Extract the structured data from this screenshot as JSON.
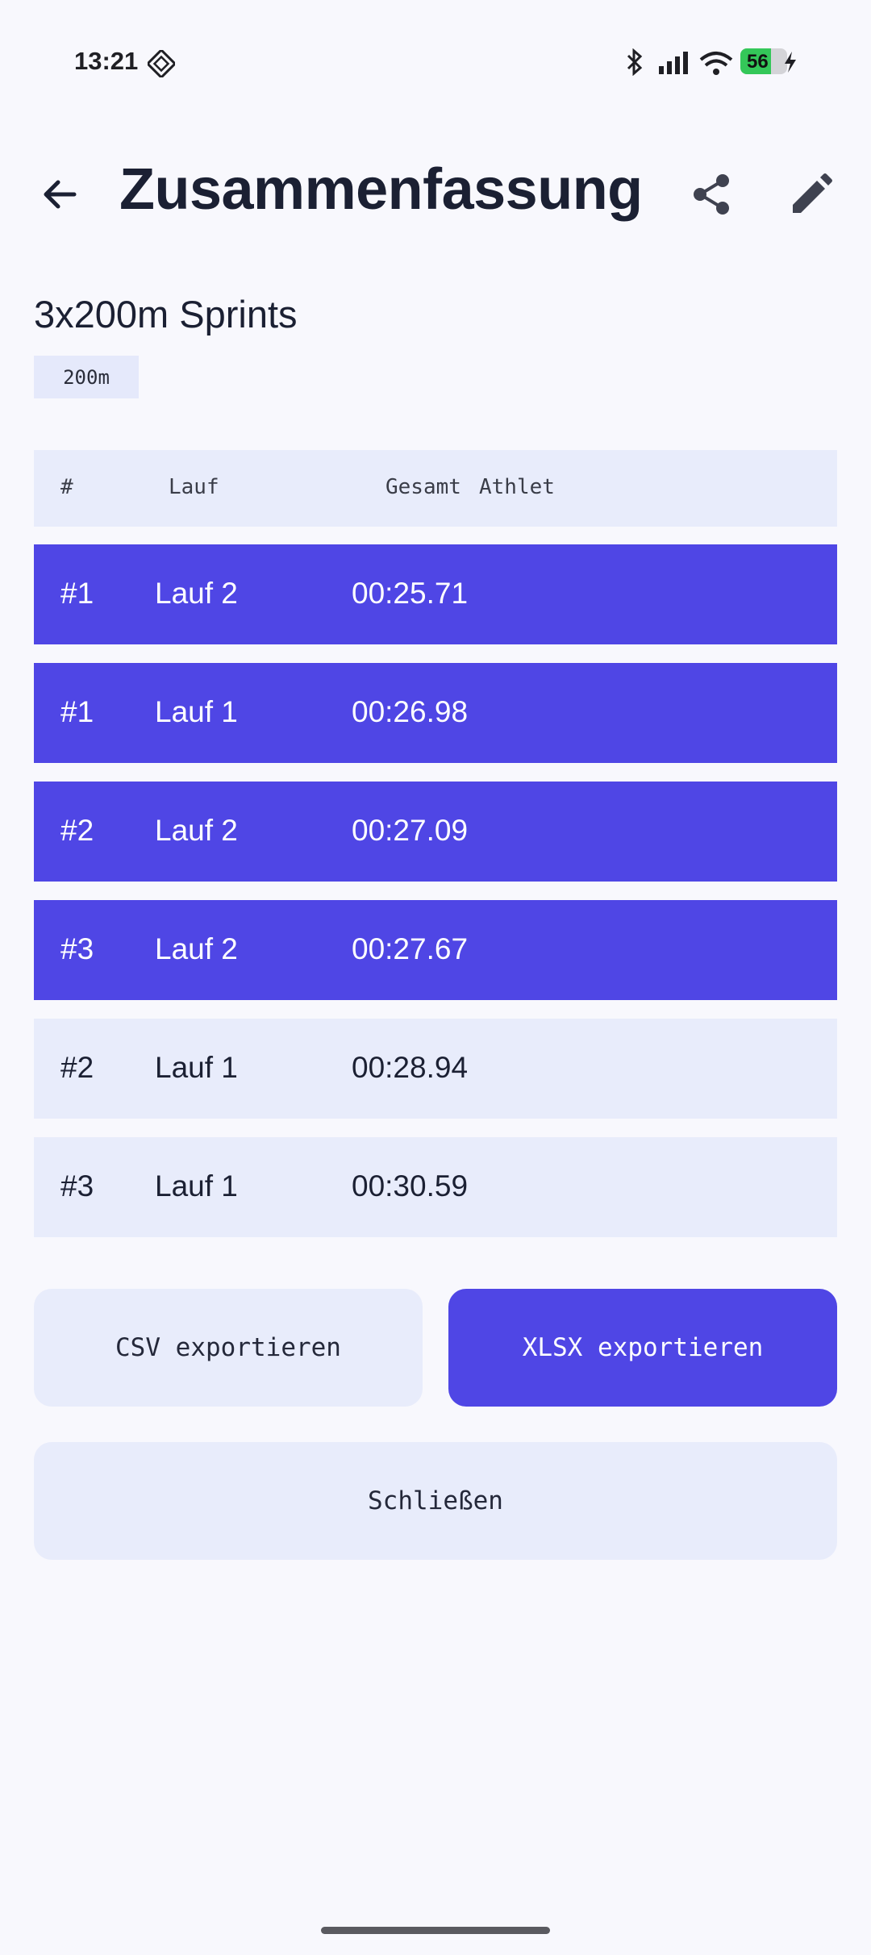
{
  "status_bar": {
    "time": "13:21",
    "battery_level": "56",
    "icons": [
      "debug-icon",
      "bluetooth-icon",
      "signal-icon",
      "wifi-icon",
      "battery-icon",
      "charging-icon"
    ]
  },
  "app_bar": {
    "title": "Zusammenfassung",
    "back_icon": "arrow-left-icon",
    "share_icon": "share-icon",
    "edit_icon": "pencil-icon"
  },
  "session": {
    "name": "3x200m Sprints",
    "distance": "200m"
  },
  "table": {
    "headers": {
      "rank": "#",
      "run": "Lauf",
      "total": "Gesamt",
      "athlete": "Athlet"
    },
    "rows": [
      {
        "rank": "#1",
        "run": "Lauf 2",
        "time": "00:25.71",
        "athlete": "",
        "highlighted": true
      },
      {
        "rank": "#1",
        "run": "Lauf 1",
        "time": "00:26.98",
        "athlete": "",
        "highlighted": true
      },
      {
        "rank": "#2",
        "run": "Lauf 2",
        "time": "00:27.09",
        "athlete": "",
        "highlighted": true
      },
      {
        "rank": "#3",
        "run": "Lauf 2",
        "time": "00:27.67",
        "athlete": "",
        "highlighted": true
      },
      {
        "rank": "#2",
        "run": "Lauf 1",
        "time": "00:28.94",
        "athlete": "",
        "highlighted": false
      },
      {
        "rank": "#3",
        "run": "Lauf 1",
        "time": "00:30.59",
        "athlete": "",
        "highlighted": false
      }
    ]
  },
  "actions": {
    "csv_label": "CSV exportieren",
    "xlsx_label": "XLSX exportieren",
    "close_label": "Schließen"
  },
  "colors": {
    "accent": "#4f46e5",
    "surface": "#e8ecfb",
    "background": "#f8f8fd",
    "text": "#1b2033"
  }
}
